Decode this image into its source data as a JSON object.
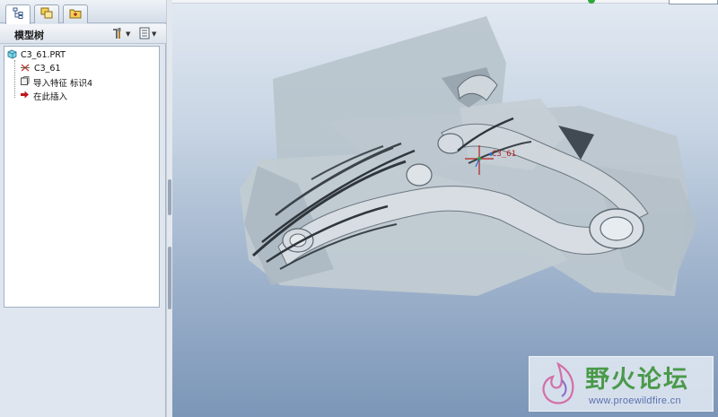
{
  "navigator": {
    "tabs": [
      {
        "name": "model-tree",
        "icon": "model-tree-icon",
        "active": true
      },
      {
        "name": "layers",
        "icon": "layers-icon",
        "active": false
      },
      {
        "name": "favorites",
        "icon": "folder-icon",
        "active": false
      }
    ],
    "tree_title": "模型树",
    "tree_items": [
      {
        "label": "C3_61.PRT",
        "icon": "part-icon"
      },
      {
        "label": "C3_61",
        "icon": "csys-icon"
      },
      {
        "label": "导入特征 标识4",
        "icon": "import-feature-icon"
      },
      {
        "label": "在此插入",
        "icon": "insert-arrow-icon"
      }
    ]
  },
  "viewport": {
    "csys_label": "C3_61"
  },
  "watermark": {
    "title": "野火论坛",
    "url": "www.proewildfire.cn"
  },
  "colors": {
    "model_fill": "#c7d0d7",
    "status_green": "#2fa83a",
    "insert_arrow": "#c0141b",
    "watermark_green": "#4a9a4a"
  }
}
